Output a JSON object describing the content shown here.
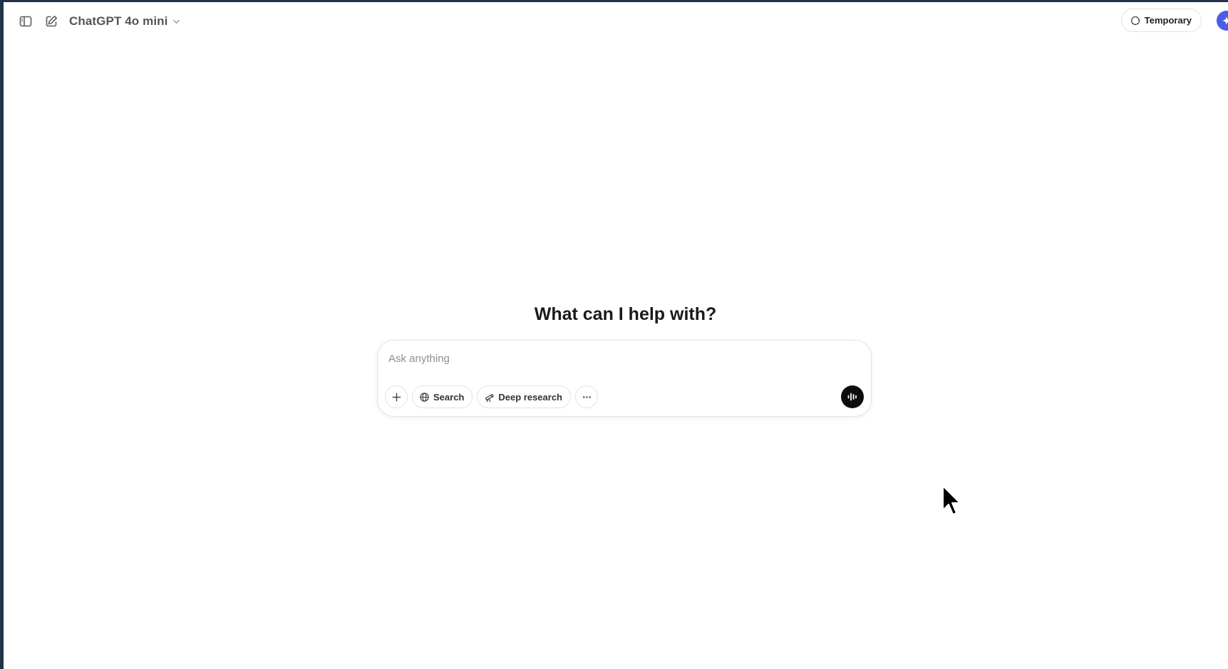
{
  "header": {
    "model_name": "ChatGPT 4o mini",
    "temporary_label": "Temporary"
  },
  "icons": {
    "sidebar_toggle": "sidebar-toggle-icon",
    "new_chat": "new-chat-icon",
    "model_dropdown": "chevron-down-icon",
    "temporary": "temporary-chat-icon",
    "avatar": "avatar-icon",
    "add": "plus-icon",
    "search": "globe-icon",
    "deep_research": "telescope-icon",
    "more": "more-horizontal-icon",
    "voice": "voice-waveform-icon"
  },
  "main": {
    "headline": "What can I help with?"
  },
  "composer": {
    "placeholder": "Ask anything",
    "search_label": "Search",
    "deep_research_label": "Deep research"
  },
  "colors": {
    "outer_frame": "#22324a",
    "background": "#ffffff",
    "avatar": "#4a5de8",
    "voice_button": "#0d0d0d",
    "border": "#e3e3e3"
  }
}
